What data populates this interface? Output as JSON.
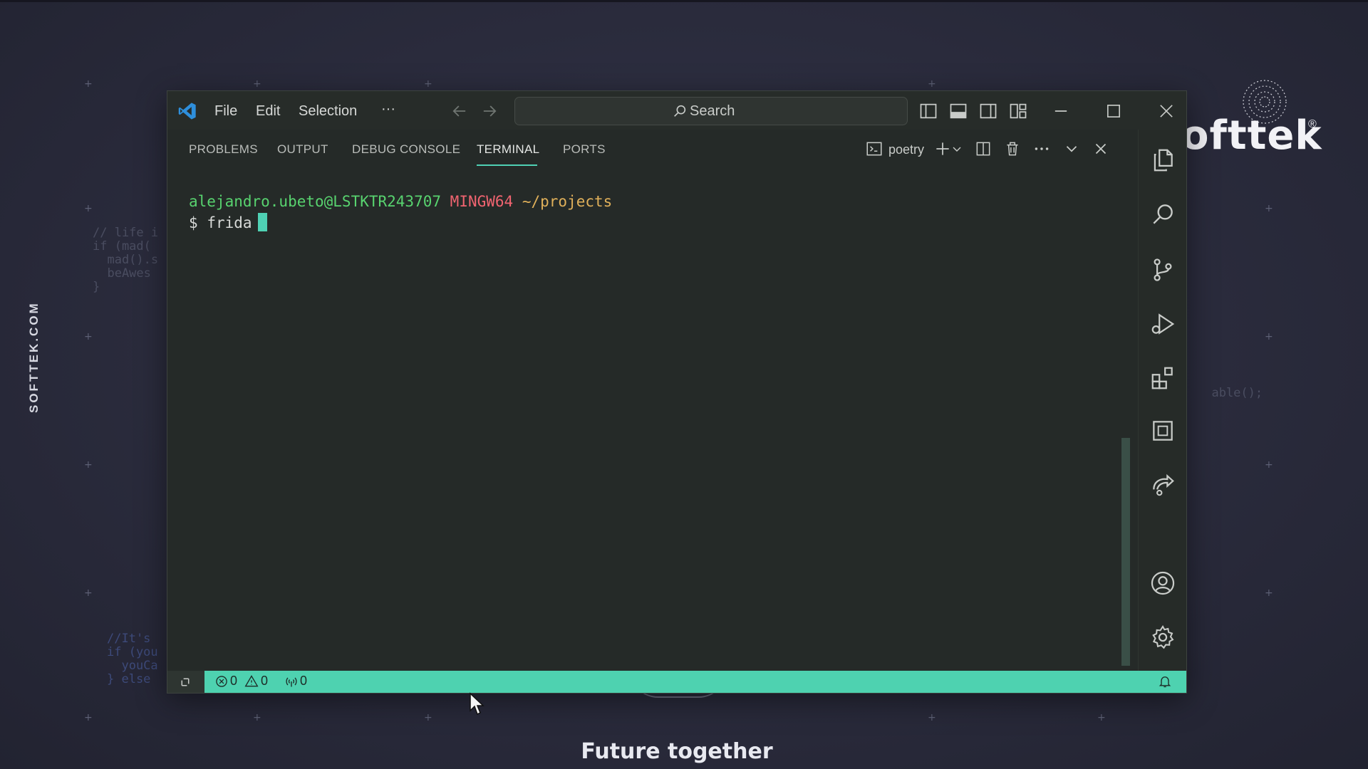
{
  "background": {
    "vertical_brand": "SOFTTEK.COM",
    "brand_name": "ofttek",
    "brand_reg": "®",
    "tagline": "Future together",
    "code_left_1": "// life i\nif (mad(\n  mad().s\n  beAwes\n}",
    "code_left_2": "//It's\nif (you\n  youCa\n} else",
    "code_right": "  able();"
  },
  "window": {
    "menu": [
      "File",
      "Edit",
      "Selection",
      "···"
    ],
    "search_label": "Search"
  },
  "panel": {
    "tabs": [
      "PROBLEMS",
      "OUTPUT",
      "DEBUG CONSOLE",
      "TERMINAL",
      "PORTS"
    ],
    "active_tab": "TERMINAL",
    "terminal_profile": "poetry"
  },
  "terminal": {
    "user_host": "alejandro.ubeto@LSTKTR243707",
    "system": "MINGW64",
    "path": "~/projects",
    "prompt_symbol": "$",
    "command": "frida"
  },
  "statusbar": {
    "errors": "0",
    "warnings": "0",
    "ports": "0"
  },
  "colors": {
    "accent": "#4ed2b0",
    "user_host": "#58d36f",
    "system": "#f06470",
    "path": "#e0b05a"
  }
}
